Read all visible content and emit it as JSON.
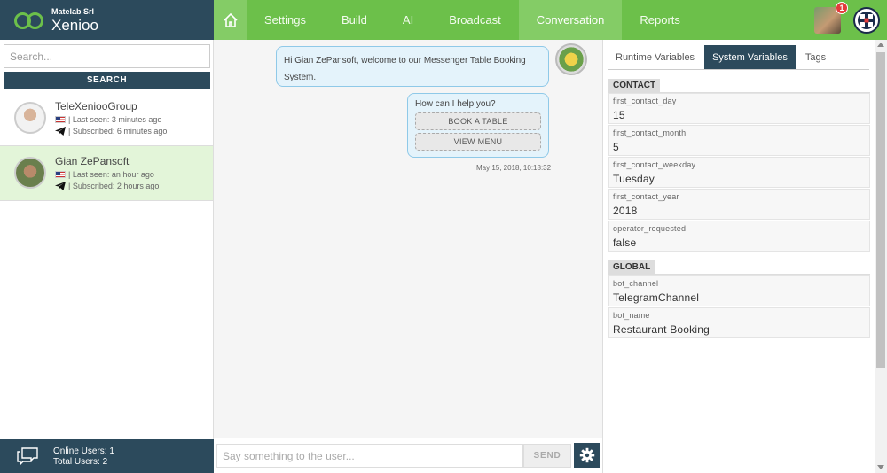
{
  "brand": {
    "company": "Matelab Srl",
    "name": "Xenioo"
  },
  "nav": {
    "items": [
      {
        "label": "Settings"
      },
      {
        "label": "Build"
      },
      {
        "label": "AI"
      },
      {
        "label": "Broadcast"
      },
      {
        "label": "Conversation",
        "active": true
      },
      {
        "label": "Reports"
      }
    ],
    "notification_count": "1"
  },
  "search": {
    "placeholder": "Search...",
    "button_label": "SEARCH"
  },
  "users": [
    {
      "name": "TeleXeniooGroup",
      "last_seen": "| Last seen: 3 minutes ago",
      "subscribed": "| Subscribed: 6 minutes ago"
    },
    {
      "name": "Gian ZePansoft",
      "last_seen": "| Last seen: an hour ago",
      "subscribed": "| Subscribed: 2 hours ago",
      "selected": true
    }
  ],
  "footer": {
    "online": "Online Users: 1",
    "total": "Total Users: 2"
  },
  "conversation": {
    "welcome": "Hi Gian ZePansoft, welcome to our Messenger Table Booking System.",
    "prompt": "How can I help you?",
    "options": [
      "BOOK A TABLE",
      "VIEW MENU"
    ],
    "timestamp": "May 15, 2018, 10:18:32"
  },
  "composer": {
    "placeholder": "Say something to the user...",
    "send_label": "SEND"
  },
  "variables": {
    "tabs": [
      "Runtime Variables",
      "System Variables",
      "Tags"
    ],
    "active_tab": "System Variables",
    "contact_label": "CONTACT",
    "contact": [
      {
        "name": "first_contact_day",
        "value": "15"
      },
      {
        "name": "first_contact_month",
        "value": "5"
      },
      {
        "name": "first_contact_weekday",
        "value": "Tuesday"
      },
      {
        "name": "first_contact_year",
        "value": "2018"
      },
      {
        "name": "operator_requested",
        "value": "false"
      }
    ],
    "global_label": "GLOBAL",
    "global": [
      {
        "name": "bot_channel",
        "value": "TelegramChannel"
      },
      {
        "name": "bot_name",
        "value": "Restaurant Booking"
      }
    ]
  },
  "colors": {
    "header_dark": "#2c4a5c",
    "nav_green": "#6cc04a",
    "nav_active": "#84cc66",
    "selected_row": "#e3f5d9",
    "bubble": "#e4f3fb"
  }
}
